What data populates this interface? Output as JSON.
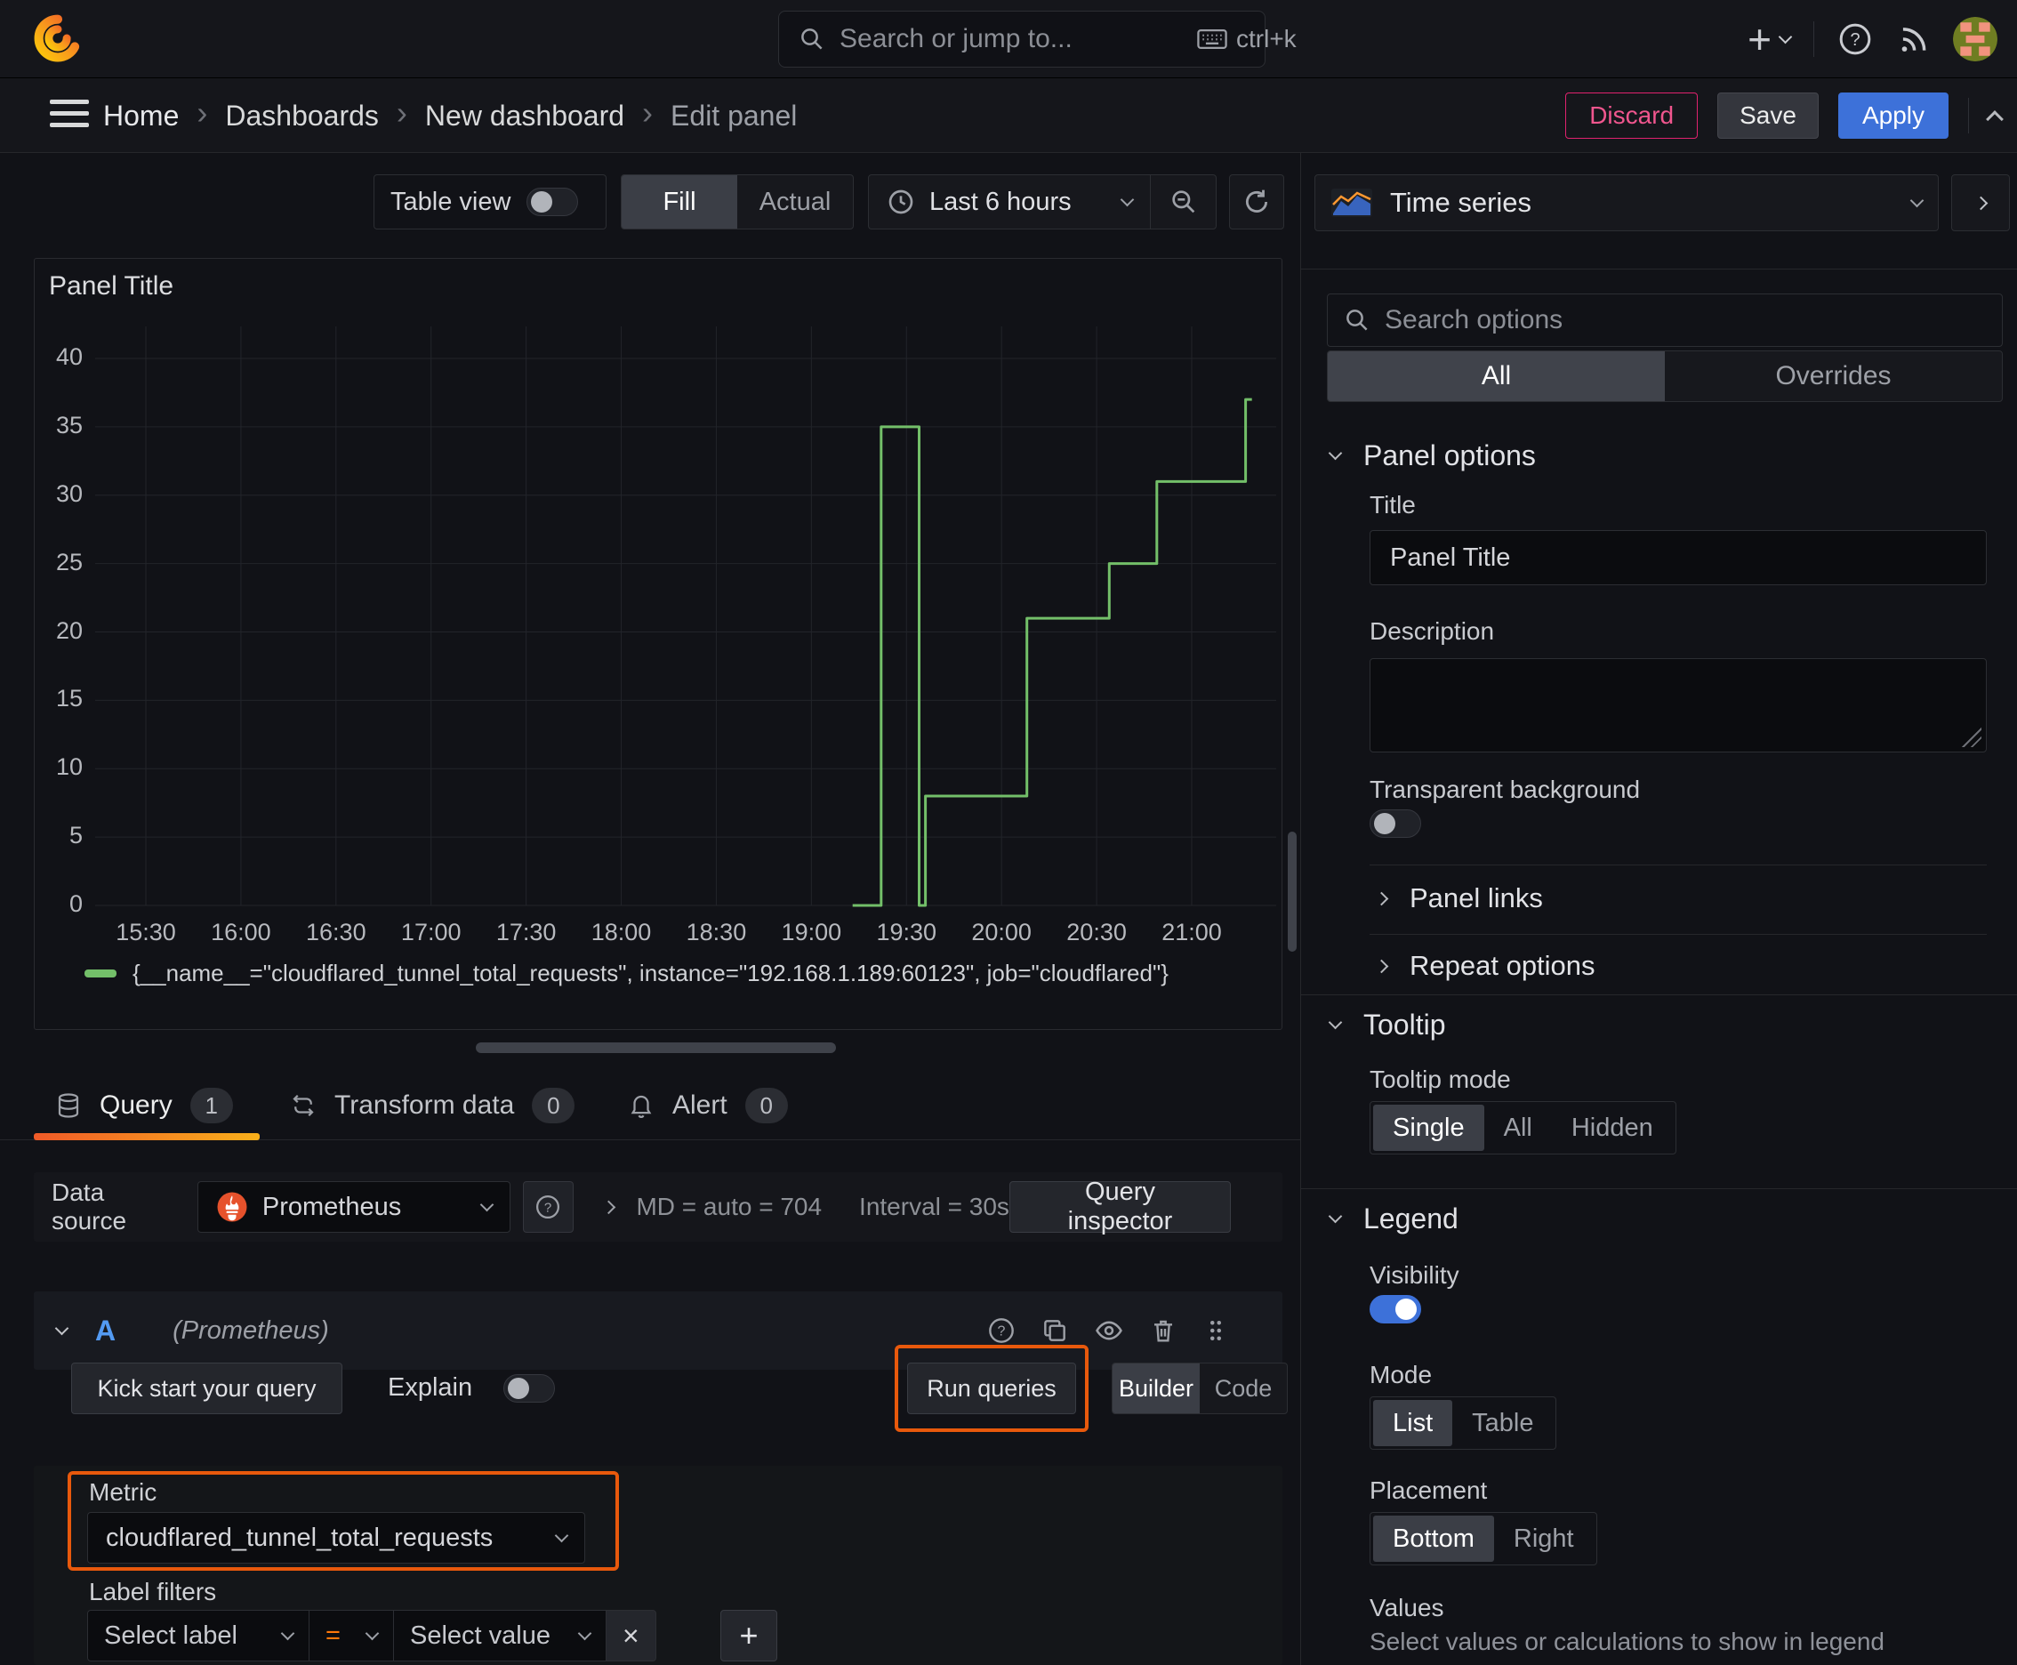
{
  "topbar": {
    "search_placeholder": "Search or jump to...",
    "shortcut": "ctrl+k"
  },
  "breadcrumb": {
    "items": [
      "Home",
      "Dashboards",
      "New dashboard",
      "Edit panel"
    ]
  },
  "actions": {
    "discard": "Discard",
    "save": "Save",
    "apply": "Apply"
  },
  "toolbar": {
    "table_view": "Table view",
    "fill": "Fill",
    "actual": "Actual",
    "time_range": "Last 6 hours"
  },
  "panel": {
    "title": "Panel Title"
  },
  "chart_data": {
    "type": "line",
    "step": true,
    "title": "Panel Title",
    "x_ticks": [
      "15:30",
      "16:00",
      "16:30",
      "17:00",
      "17:30",
      "18:00",
      "18:30",
      "19:00",
      "19:30",
      "20:00",
      "20:30",
      "21:00"
    ],
    "x_tick_minutes": [
      30,
      60,
      90,
      120,
      150,
      180,
      210,
      240,
      270,
      300,
      330,
      360
    ],
    "y_ticks": [
      0,
      5,
      10,
      15,
      20,
      25,
      30,
      35,
      40
    ],
    "y_range": [
      0,
      42
    ],
    "x_range_minutes": [
      14,
      385
    ],
    "grid": true,
    "legend_position": "bottom",
    "series": [
      {
        "name": "{__name__=\"cloudflared_tunnel_total_requests\", instance=\"192.168.1.189:60123\", job=\"cloudflared\"}",
        "color": "#73bf69",
        "points_format": "[minutes_after_15:00, value]",
        "points": [
          [
            253,
            0
          ],
          [
            262,
            0
          ],
          [
            262,
            35
          ],
          [
            274,
            35
          ],
          [
            274,
            0
          ],
          [
            276,
            0
          ],
          [
            276,
            8
          ],
          [
            308,
            8
          ],
          [
            308,
            21
          ],
          [
            334,
            21
          ],
          [
            334,
            25
          ],
          [
            349,
            25
          ],
          [
            349,
            31
          ],
          [
            377,
            31
          ],
          [
            377,
            37
          ],
          [
            379,
            37
          ]
        ]
      }
    ]
  },
  "tabs": {
    "query": "Query",
    "query_count": "1",
    "transform": "Transform data",
    "transform_count": "0",
    "alert": "Alert",
    "alert_count": "0"
  },
  "datasource": {
    "label": "Data source",
    "name": "Prometheus",
    "md": "MD = auto = 704",
    "interval": "Interval = 30s",
    "inspector": "Query inspector"
  },
  "query_row": {
    "ref_id": "A",
    "ds_hint": "(Prometheus)"
  },
  "query_editor": {
    "kickstart": "Kick start your query",
    "explain": "Explain",
    "run": "Run queries",
    "builder": "Builder",
    "code": "Code",
    "metric_label": "Metric",
    "metric_value": "cloudflared_tunnel_total_requests",
    "label_filters": "Label filters",
    "select_label": "Select label",
    "operator": "=",
    "select_value": "Select value",
    "remove": "×",
    "add": "+"
  },
  "sidebar": {
    "viz": "Time series",
    "search_placeholder": "Search options",
    "tabs": {
      "all": "All",
      "overrides": "Overrides"
    },
    "panel_options": {
      "title": "Panel options",
      "title_label": "Title",
      "title_value": "Panel Title",
      "description_label": "Description",
      "transparent": "Transparent background"
    },
    "collapsed": {
      "panel_links": "Panel links",
      "repeat_options": "Repeat options"
    },
    "tooltip": {
      "title": "Tooltip",
      "mode_label": "Tooltip mode",
      "options": [
        "Single",
        "All",
        "Hidden"
      ],
      "selected": "Single"
    },
    "legend": {
      "title": "Legend",
      "visibility": "Visibility",
      "mode_label": "Mode",
      "modes": [
        "List",
        "Table"
      ],
      "selected_mode": "List",
      "placement_label": "Placement",
      "placements": [
        "Bottom",
        "Right"
      ],
      "selected_placement": "Bottom",
      "values_label": "Values",
      "values_hint": "Select values or calculations to show in legend"
    }
  },
  "colors": {
    "accent_orange": "#ff780a",
    "annotation_orange": "#e8590c",
    "series_green": "#73bf69",
    "primary_blue": "#3d71d9",
    "destructive_pink": "#e0226e",
    "prometheus_orange": "#e6522c",
    "canvas": "#111217"
  }
}
